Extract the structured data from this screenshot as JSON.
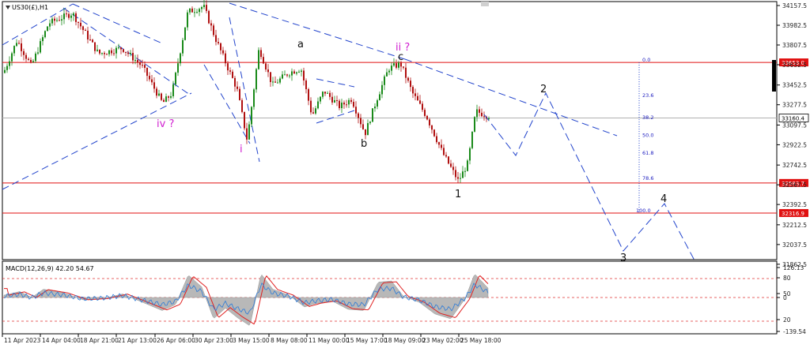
{
  "symbol_label": "US30(£),H1",
  "indicator_label": "MACD(12,26,9) 42.20 54.67",
  "colors": {
    "red_line": "#e01010",
    "blue_dash": "#2244cc",
    "wave_magenta": "#d020d0",
    "candle": "#1a8a1a",
    "candle_down": "#b01010",
    "macd_hist": "#b8b8b8",
    "macd_signal": "#e02020",
    "macd_main": "#2a7ad8"
  },
  "chart_data": {
    "type": "candlestick",
    "price_axis": {
      "ylim": [
        31780,
        34200
      ],
      "ticks": [
        "34157.5",
        "33982.5",
        "33807.5",
        "33632.5",
        "33452.5",
        "33277.5",
        "33097.5",
        "32922.5",
        "32742.5",
        "32567.5",
        "32392.5",
        "32212.5",
        "32037.5",
        "31862.5"
      ]
    },
    "time_axis": {
      "labels": [
        "11 Apr 2023",
        "14 Apr 04:00",
        "18 Apr 21:00",
        "21 Apr 13:00",
        "26 Apr 06:00",
        "30 Apr 23:00",
        "3 May 15:00",
        "8 May 08:00",
        "11 May 00:00",
        "15 May 17:00",
        "18 May 09:00",
        "23 May 02:00",
        "25 May 18:00"
      ]
    },
    "horizontal_levels": [
      {
        "price": 33653.0,
        "label": "33653.0"
      },
      {
        "price": 32583.7,
        "label": "32583.7"
      },
      {
        "price": 32316.9,
        "label": "32316.9"
      }
    ],
    "current_price": {
      "price": 33160.4,
      "label": "33160.4"
    },
    "fibonacci": {
      "top_price": 33653.0,
      "bottom_price": 32316.9,
      "levels": [
        {
          "ratio": 0.0,
          "label": "0.0"
        },
        {
          "ratio": 0.236,
          "label": "23.6"
        },
        {
          "ratio": 0.382,
          "label": "38.2"
        },
        {
          "ratio": 0.5,
          "label": "50.0"
        },
        {
          "ratio": 0.618,
          "label": "61.8"
        },
        {
          "ratio": 0.786,
          "label": "78.6"
        },
        {
          "ratio": 1.0,
          "label": "100.0"
        }
      ]
    },
    "wave_labels": [
      {
        "text": "iv ?",
        "style": "magenta"
      },
      {
        "text": "i",
        "style": "magenta"
      },
      {
        "text": "a",
        "style": "black"
      },
      {
        "text": "b",
        "style": "black"
      },
      {
        "text": "ii ?",
        "style": "magenta"
      },
      {
        "text": "c",
        "style": "black"
      },
      {
        "text": "1",
        "style": "black"
      },
      {
        "text": "2",
        "style": "black"
      },
      {
        "text": "3",
        "style": "black"
      },
      {
        "text": "4",
        "style": "black"
      }
    ],
    "macd_axis": {
      "ticks": [
        "126.13",
        "80",
        "50",
        "0",
        "20",
        "-139.54"
      ]
    }
  }
}
